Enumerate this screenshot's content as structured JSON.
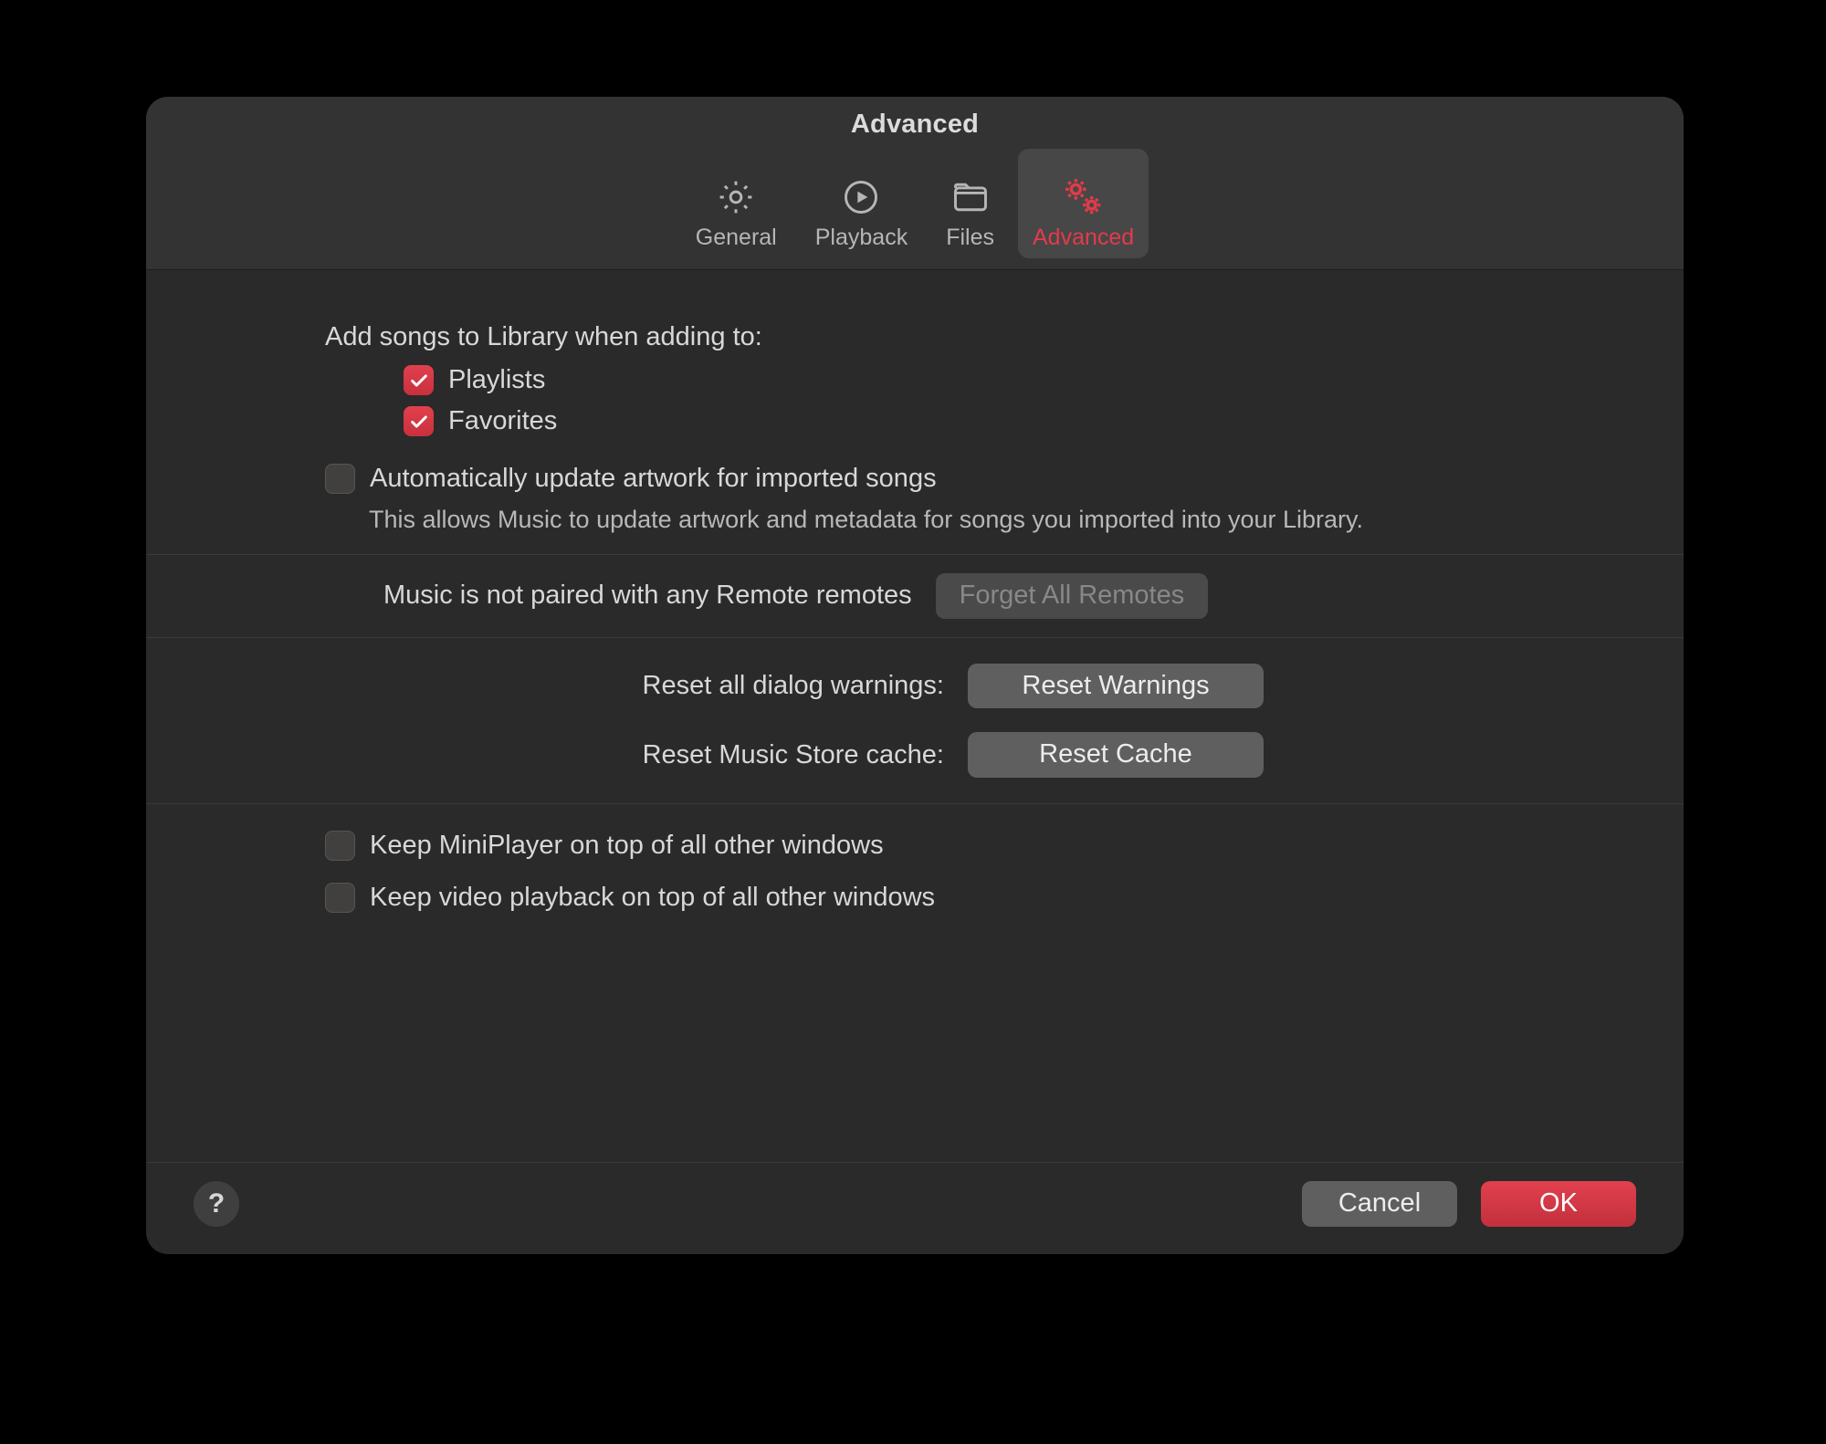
{
  "window": {
    "title": "Advanced"
  },
  "tabs": [
    {
      "label": "General"
    },
    {
      "label": "Playback"
    },
    {
      "label": "Files"
    },
    {
      "label": "Advanced"
    }
  ],
  "library": {
    "heading": "Add songs to Library when adding to:",
    "playlists": "Playlists",
    "favorites": "Favorites",
    "auto_artwork": "Automatically update artwork for imported songs",
    "auto_artwork_desc": "This allows Music to update artwork and metadata for songs you imported into your Library."
  },
  "remotes": {
    "status": "Music is not paired with any Remote remotes",
    "forget_btn": "Forget All Remotes"
  },
  "reset": {
    "warnings_label": "Reset all dialog warnings:",
    "warnings_btn": "Reset Warnings",
    "cache_label": "Reset Music Store cache:",
    "cache_btn": "Reset Cache"
  },
  "ontop": {
    "miniplayer": "Keep MiniPlayer on top of all other windows",
    "video": "Keep video playback on top of all other windows"
  },
  "footer": {
    "help": "?",
    "cancel": "Cancel",
    "ok": "OK"
  }
}
